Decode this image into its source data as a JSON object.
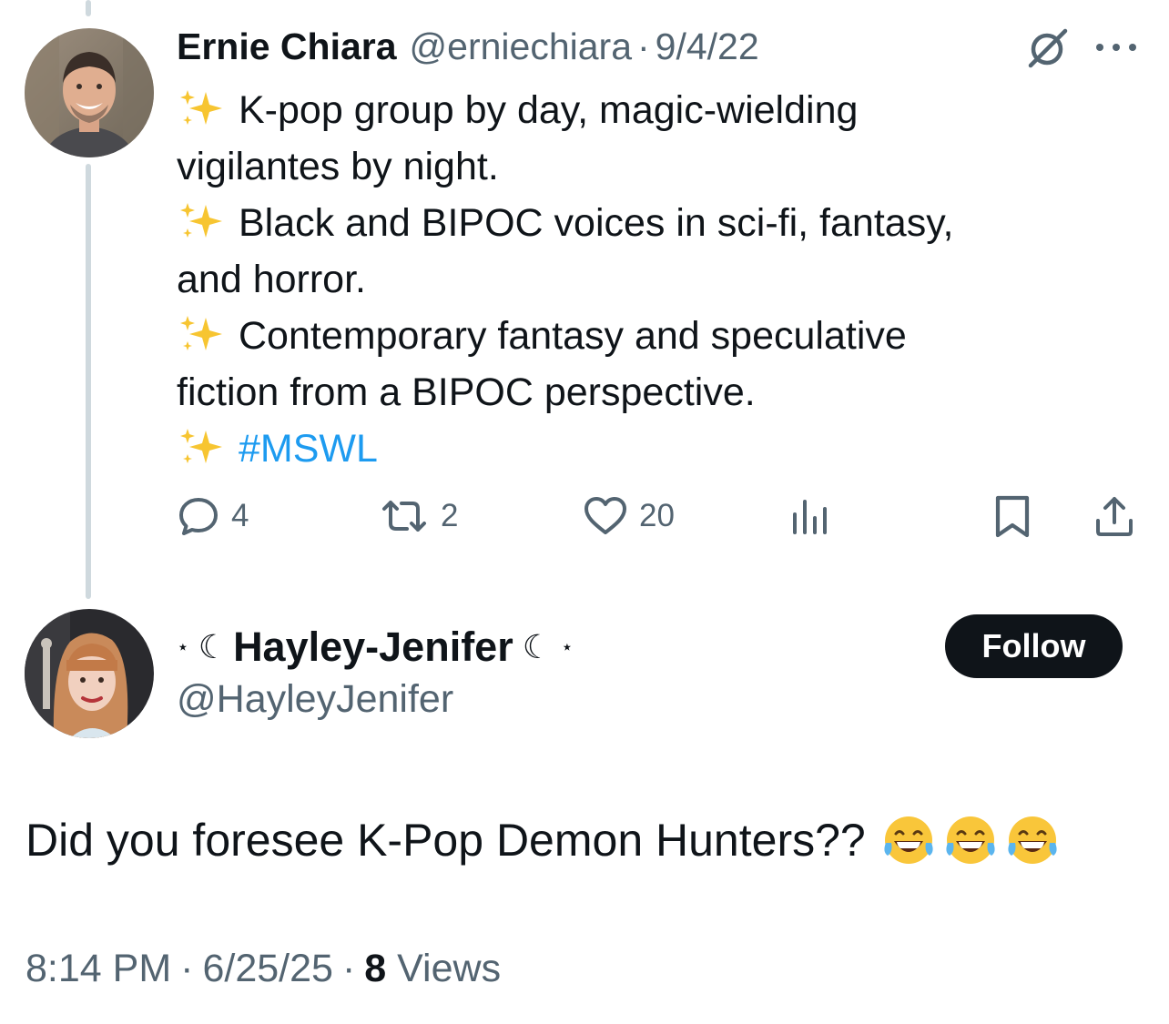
{
  "parent_tweet": {
    "author_name": "Ernie Chiara",
    "handle": "@erniechiara",
    "separator": "·",
    "date": "9/4/22",
    "lines": [
      "K-pop group by day, magic-wielding",
      "vigilantes by night.",
      "Black and BIPOC voices in sci-fi, fantasy,",
      "and horror.",
      "Contemporary fantasy and speculative",
      "fiction from a BIPOC perspective.",
      "#MSWL"
    ],
    "actions": {
      "replies": "4",
      "reposts": "2",
      "likes": "20"
    }
  },
  "reply_tweet": {
    "name_prefix_star": "⋆",
    "name_prefix_moon": "☾",
    "author_name": "Hayley-Jenifer",
    "name_suffix_moon": "☾",
    "name_suffix_star": "⋆",
    "handle": "@HayleyJenifer",
    "follow_label": "Follow",
    "text": "Did you foresee K-Pop Demon Hunters??",
    "emoji": [
      "face-with-tears-of-joy",
      "face-with-tears-of-joy",
      "face-with-tears-of-joy"
    ],
    "time": "8:14 PM",
    "date": "6/25/25",
    "separator": "·",
    "views_count": "8",
    "views_label": "Views"
  },
  "colors": {
    "text": "#0f1419",
    "secondary": "#536471",
    "link": "#1d9bf0",
    "thread_line": "#cfd9de",
    "follow_bg": "#0f1419"
  }
}
